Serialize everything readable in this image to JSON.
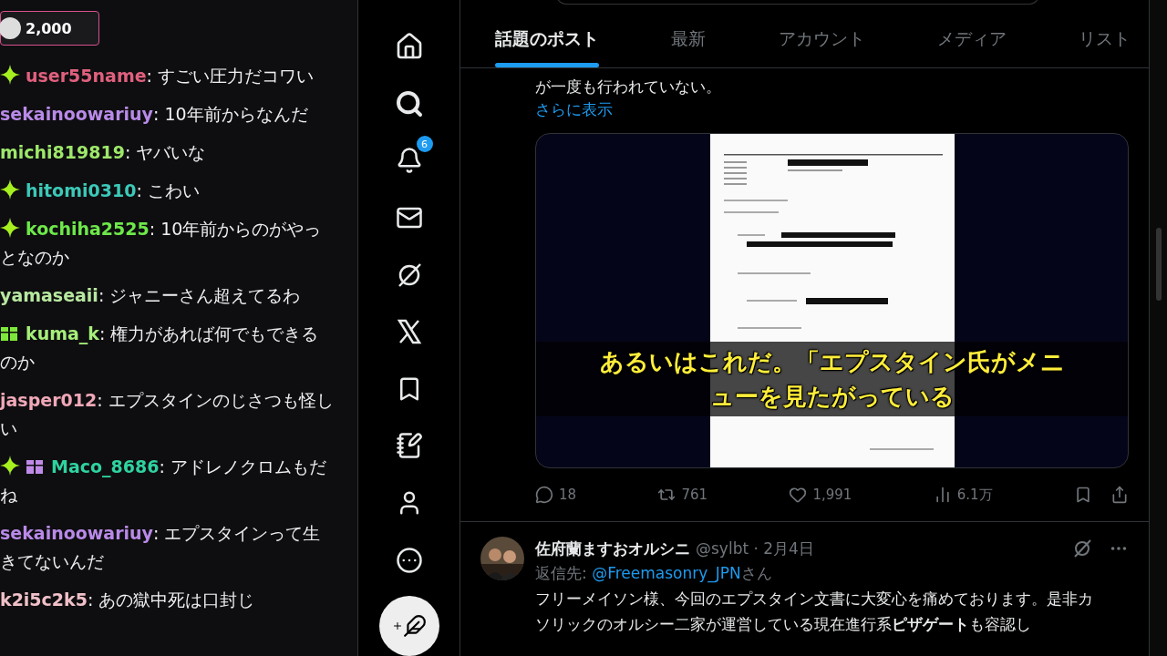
{
  "chat": {
    "points": "2,000",
    "messages": [
      {
        "user": "user55name",
        "color": "#e0607e",
        "sparkle": true,
        "gift": false,
        "text": ": すごい圧力だコワい"
      },
      {
        "user": "sekainoowariuy",
        "color": "#b98ae8",
        "sparkle": false,
        "gift": false,
        "text": ": 10年前からなんだ"
      },
      {
        "user": "michi819819",
        "color": "#9ee86a",
        "sparkle": false,
        "gift": false,
        "text": ": ヤバいな"
      },
      {
        "user": "hitomi0310",
        "color": "#3cc9b8",
        "sparkle": true,
        "gift": false,
        "text": ": こわい"
      },
      {
        "user": "kochiha2525",
        "color": "#6ee84a",
        "sparkle": true,
        "gift": false,
        "text": ": 10年前からのがやっとなのか"
      },
      {
        "user": "yamaseaii",
        "color": "#b8e8a0",
        "sparkle": false,
        "gift": false,
        "text": ": ジャニーさん超えてるわ"
      },
      {
        "user": "kuma_k",
        "color": "#a6ef7a",
        "sparkle": false,
        "gift": {
          "color": "#7ee83a"
        },
        "text": ": 権力があれば何でもできるのか"
      },
      {
        "user": "jasper012",
        "color": "#f0a8b8",
        "sparkle": false,
        "gift": false,
        "text": ": エプスタインのじさつも怪しい"
      },
      {
        "user": "Maco_8686",
        "color": "#2fd3a0",
        "sparkle": true,
        "gift": {
          "color": "#c08ae8"
        },
        "text": ": アドレノクロムもだね"
      },
      {
        "user": "sekainoowariuy",
        "color": "#b98ae8",
        "sparkle": false,
        "gift": false,
        "text": ": エプスタインって生きてないんだ"
      },
      {
        "user": "k2i5c2k5",
        "color": "#f0c0c8",
        "sparkle": false,
        "gift": false,
        "text": ": あの獄中死は口封じ"
      }
    ]
  },
  "nav": {
    "notification_count": "6"
  },
  "tabs": [
    {
      "label": "話題のポスト",
      "selected": true
    },
    {
      "label": "最新",
      "selected": false
    },
    {
      "label": "アカウント",
      "selected": false
    },
    {
      "label": "メディア",
      "selected": false
    },
    {
      "label": "リスト",
      "selected": false
    }
  ],
  "post": {
    "text": "が一度も行われていない。",
    "show_more": "さらに表示",
    "media": {
      "caption_lines": [
        "あるいはこれだ。「エプスタイン氏がメニ",
        "ューを見たがっている"
      ]
    },
    "stats": {
      "replies": "18",
      "reposts": "761",
      "likes": "1,991",
      "views": "6.1万"
    }
  },
  "reply": {
    "name": "佐府蘭ますおオルシニ",
    "handle": "@sylbt · 2月4日",
    "reply_to_label": "返信先:",
    "reply_to": "@Freemasonry_JPN",
    "reply_to_suffix": "さん",
    "text": "フリーメイソン様、今回のエプスタイン文書に大変心を痛めております。是非カソリックのオルシー二家が運営している現在進行系**ピザゲート**も容認し"
  }
}
